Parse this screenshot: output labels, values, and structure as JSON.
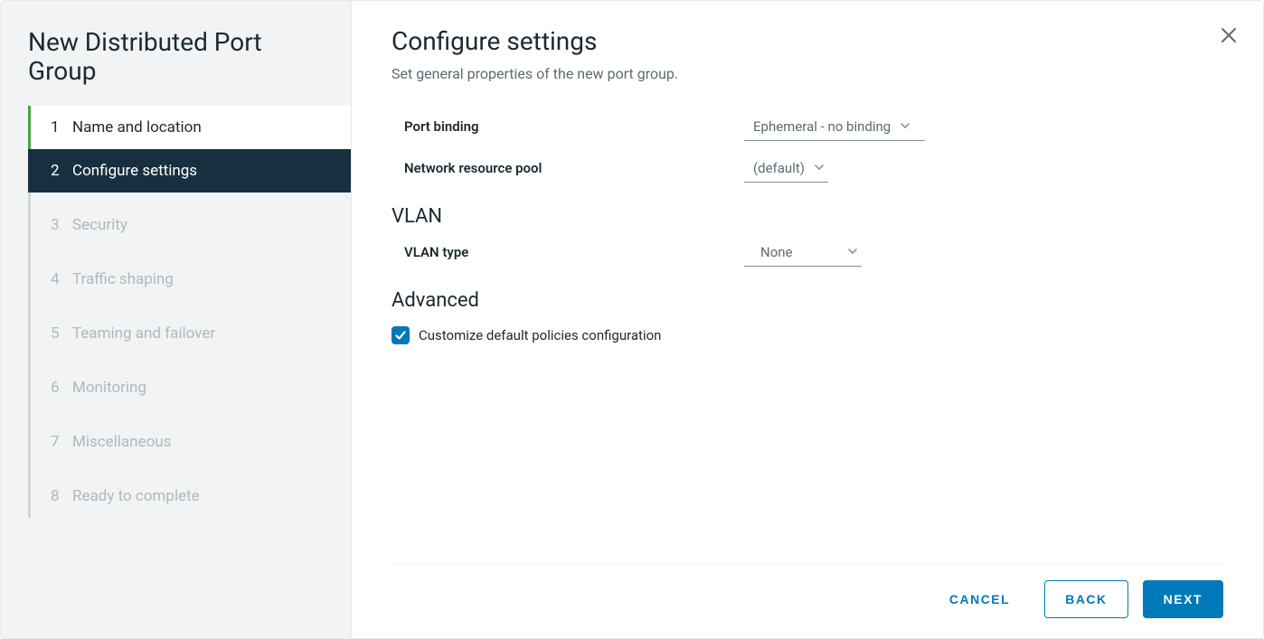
{
  "wizard": {
    "title": "New Distributed Port Group",
    "steps": [
      {
        "num": "1",
        "label": "Name and location",
        "state": "completed"
      },
      {
        "num": "2",
        "label": "Configure settings",
        "state": "active"
      },
      {
        "num": "3",
        "label": "Security",
        "state": "pending"
      },
      {
        "num": "4",
        "label": "Traffic shaping",
        "state": "pending"
      },
      {
        "num": "5",
        "label": "Teaming and failover",
        "state": "pending"
      },
      {
        "num": "6",
        "label": "Monitoring",
        "state": "pending"
      },
      {
        "num": "7",
        "label": "Miscellaneous",
        "state": "pending"
      },
      {
        "num": "8",
        "label": "Ready to complete",
        "state": "pending"
      }
    ]
  },
  "page": {
    "title": "Configure settings",
    "subtitle": "Set general properties of the new port group."
  },
  "form": {
    "port_binding": {
      "label": "Port binding",
      "value": "Ephemeral - no binding"
    },
    "network_resource_pool": {
      "label": "Network resource pool",
      "value": "(default)"
    },
    "vlan_section": "VLAN",
    "vlan_type": {
      "label": "VLAN type",
      "value": "None"
    },
    "advanced_section": "Advanced",
    "customize": {
      "label": "Customize default policies configuration",
      "checked": true
    }
  },
  "buttons": {
    "cancel": "CANCEL",
    "back": "BACK",
    "next": "NEXT"
  }
}
